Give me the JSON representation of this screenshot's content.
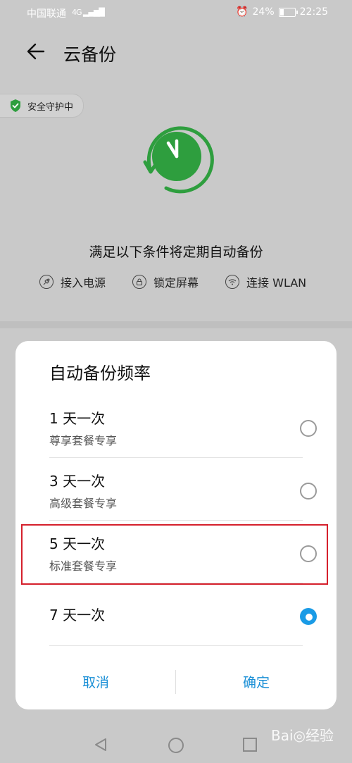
{
  "status": {
    "carrier": "中国联通",
    "signal": "4G",
    "battery": "24%",
    "time": "22:25",
    "battery_level": 0.24
  },
  "header": {
    "title": "云备份"
  },
  "badge": {
    "label": "安全守护中"
  },
  "conditions": {
    "title": "满足以下条件将定期自动备份",
    "items": [
      "接入电源",
      "锁定屏幕",
      "连接 WLAN"
    ]
  },
  "dialog": {
    "title": "自动备份频率",
    "options": [
      {
        "label": "1 天一次",
        "sub": "尊享套餐专享",
        "selected": false
      },
      {
        "label": "3 天一次",
        "sub": "高级套餐专享",
        "selected": false
      },
      {
        "label": "5 天一次",
        "sub": "标准套餐专享",
        "selected": false
      },
      {
        "label": "7 天一次",
        "sub": "",
        "selected": true
      }
    ],
    "cancel": "取消",
    "confirm": "确定"
  },
  "watermark": "Bai◎经验",
  "colors": {
    "accent": "#1a9be6",
    "green": "#2e9e3e",
    "highlight": "#d5202c"
  }
}
